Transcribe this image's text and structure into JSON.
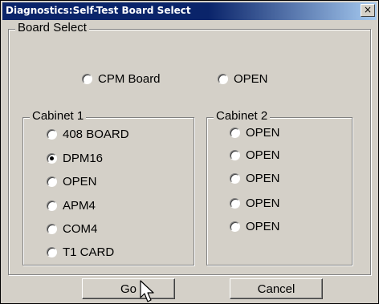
{
  "window": {
    "title": "Diagnostics:Self-Test Board Select",
    "close_label": "×"
  },
  "board_select": {
    "label": "Board Select",
    "top_options": [
      {
        "label": "CPM Board",
        "checked": false
      },
      {
        "label": "OPEN",
        "checked": false
      }
    ],
    "cabinet1": {
      "label": "Cabinet 1",
      "options": [
        {
          "label": "408 BOARD",
          "checked": false
        },
        {
          "label": "DPM16",
          "checked": true
        },
        {
          "label": "OPEN",
          "checked": false
        },
        {
          "label": "APM4",
          "checked": false
        },
        {
          "label": "COM4",
          "checked": false
        },
        {
          "label": "T1 CARD",
          "checked": false
        }
      ]
    },
    "cabinet2": {
      "label": "Cabinet 2",
      "options": [
        {
          "label": "OPEN",
          "checked": false
        },
        {
          "label": "OPEN",
          "checked": false
        },
        {
          "label": "OPEN",
          "checked": false
        },
        {
          "label": "OPEN",
          "checked": false
        },
        {
          "label": "OPEN",
          "checked": false
        }
      ]
    }
  },
  "buttons": {
    "go": "Go",
    "cancel": "Cancel"
  },
  "icons": {
    "close": "close-icon",
    "cursor": "mouse-pointer-icon"
  }
}
